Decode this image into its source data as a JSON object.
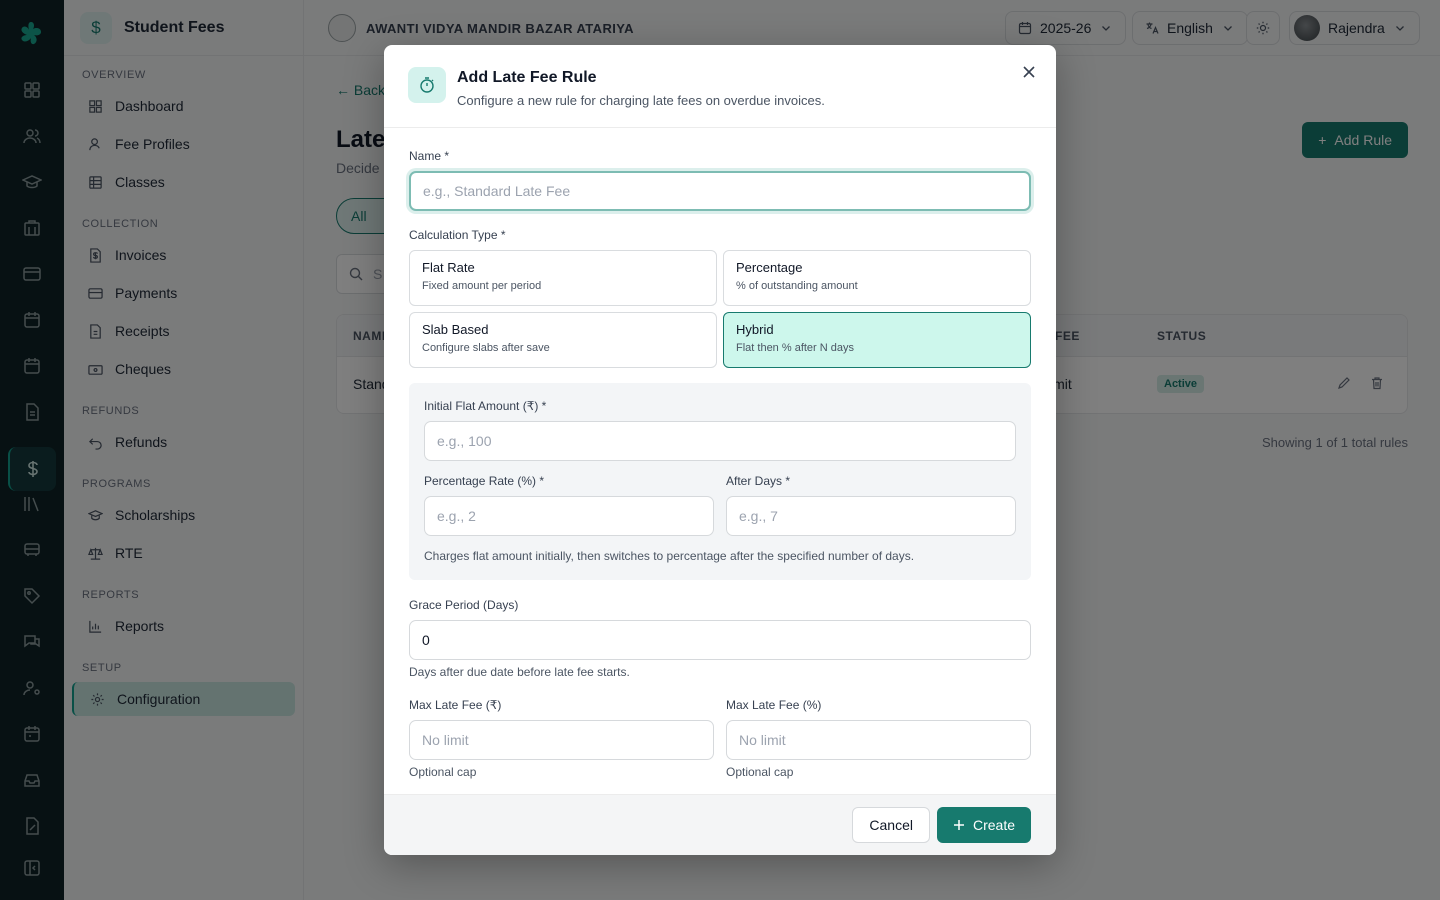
{
  "app": {
    "module_title": "Student Fees",
    "module_icon": "dollar-icon",
    "school_name": "AWANTI VIDYA MANDIR BAZAR ATARIYA",
    "academic_year": "2025-26",
    "language": "English",
    "user_name": "Rajendra"
  },
  "sidebar": {
    "sections": [
      {
        "label": "OVERVIEW"
      },
      {
        "label": "COLLECTION"
      },
      {
        "label": "REFUNDS"
      },
      {
        "label": "PROGRAMS"
      },
      {
        "label": "REPORTS"
      },
      {
        "label": "SETUP"
      }
    ],
    "items": [
      {
        "label": "Dashboard",
        "icon": "grid-icon"
      },
      {
        "label": "Fee Profiles",
        "icon": "user-icon"
      },
      {
        "label": "Classes",
        "icon": "table-icon"
      },
      {
        "label": "Invoices",
        "icon": "invoice-icon"
      },
      {
        "label": "Payments",
        "icon": "card-icon"
      },
      {
        "label": "Receipts",
        "icon": "receipt-icon"
      },
      {
        "label": "Cheques",
        "icon": "cheque-icon"
      },
      {
        "label": "Refunds",
        "icon": "undo-icon"
      },
      {
        "label": "Scholarships",
        "icon": "graduation-cap-icon"
      },
      {
        "label": "RTE",
        "icon": "scale-icon"
      },
      {
        "label": "Reports",
        "icon": "bar-chart-icon"
      },
      {
        "label": "Configuration",
        "icon": "gear-icon",
        "active": true
      }
    ]
  },
  "page": {
    "back_label": "Back",
    "title": "Late",
    "subtitle": "Decide",
    "add_rule_label": "Add Rule",
    "filter_all": "All",
    "search_placeholder": "S",
    "table": {
      "headers": {
        "name": "NAME",
        "fee": "FEE",
        "status": "STATUS"
      },
      "row": {
        "name": "Stand",
        "fee": "imit",
        "status": "Active"
      }
    },
    "showing": "Showing 1 of 1 total rules"
  },
  "modal": {
    "title": "Add Late Fee Rule",
    "subtitle": "Configure a new rule for charging late fees on overdue invoices.",
    "name_label": "Name *",
    "name_placeholder": "e.g., Standard Late Fee",
    "calc_label": "Calculation Type *",
    "options": [
      {
        "title": "Flat Rate",
        "desc": "Fixed amount per period"
      },
      {
        "title": "Percentage",
        "desc": "% of outstanding amount"
      },
      {
        "title": "Slab Based",
        "desc": "Configure slabs after save"
      },
      {
        "title": "Hybrid",
        "desc": "Flat then % after N days",
        "selected": true
      }
    ],
    "hybrid": {
      "initial_flat_label": "Initial Flat Amount (₹) *",
      "initial_flat_placeholder": "e.g., 100",
      "pct_rate_label": "Percentage Rate (%) *",
      "pct_rate_placeholder": "e.g., 2",
      "after_days_label": "After Days *",
      "after_days_placeholder": "e.g., 7",
      "help": "Charges flat amount initially, then switches to percentage after the specified number of days."
    },
    "grace_label": "Grace Period (Days)",
    "grace_value": "0",
    "grace_hint": "Days after due date before late fee starts.",
    "max_rs_label": "Max Late Fee (₹)",
    "max_rs_placeholder": "No limit",
    "max_rs_hint": "Optional cap",
    "max_pct_label": "Max Late Fee (%)",
    "max_pct_placeholder": "No limit",
    "max_pct_hint": "Optional cap",
    "cancel_label": "Cancel",
    "create_label": "Create",
    "accent_color": "#177a6e",
    "selected_bg": "#cdf7ec"
  }
}
